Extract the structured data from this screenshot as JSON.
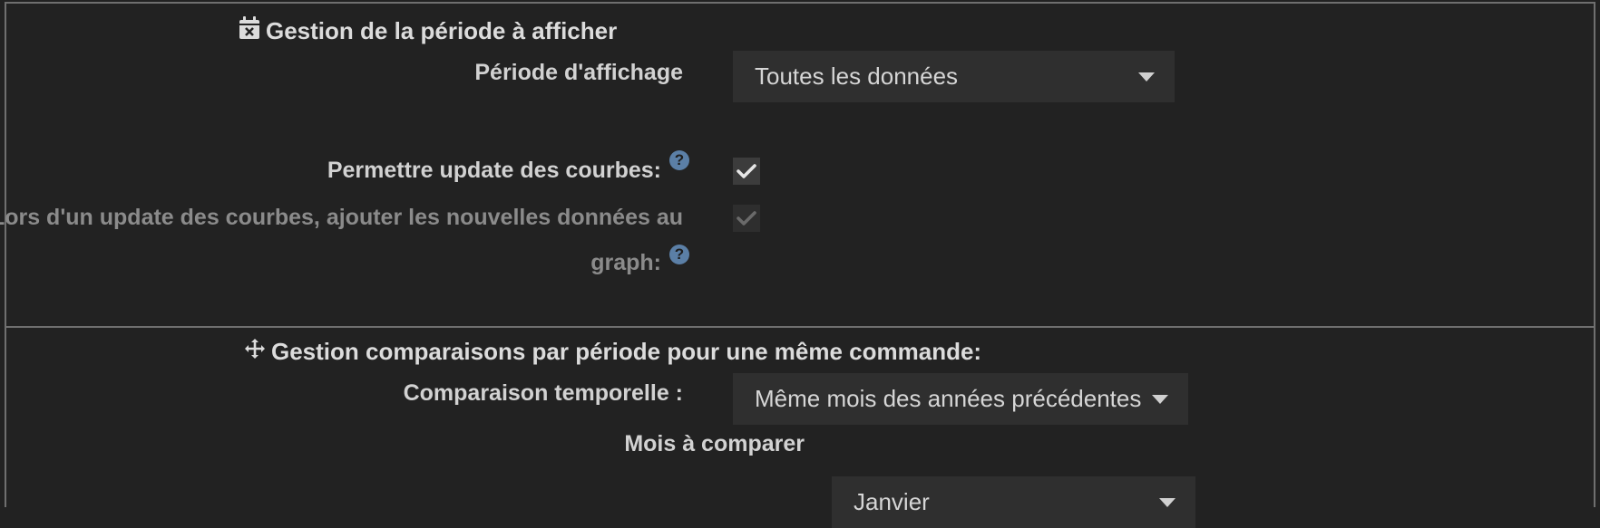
{
  "period_section": {
    "title": "Gestion de la période à afficher",
    "display_period_label": "Période d'affichage",
    "display_period_value": "Toutes les données",
    "allow_update_label": "Permettre update des courbes:",
    "allow_update_checked": true,
    "append_data_label_line1": "Lors d'un update des courbes, ajouter les nouvelles données au",
    "append_data_label_line2": "graph:",
    "append_data_checked": true,
    "help_glyph": "?"
  },
  "comparison_section": {
    "title": "Gestion comparaisons par période pour une même commande:",
    "temporal_label": "Comparaison temporelle :",
    "temporal_value": "Même mois des années précédentes",
    "month_label": "Mois à comparer",
    "month_value": "Janvier"
  },
  "colors": {
    "background": "#222222",
    "border": "#6f6f6f",
    "select_bg": "#2f2f2f",
    "help_icon": "#5b7fa6"
  },
  "icons": [
    "calendar-x-icon",
    "move-arrows-icon",
    "chevron-down-icon",
    "checkmark-icon",
    "help-icon"
  ]
}
